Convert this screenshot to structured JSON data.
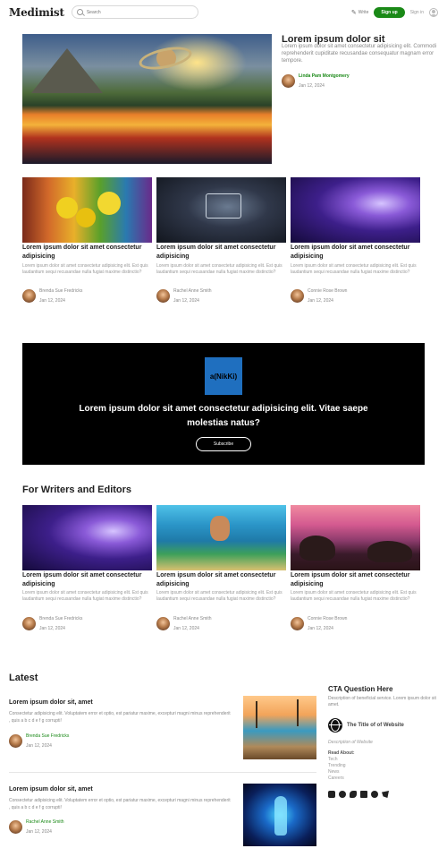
{
  "header": {
    "logo": "Medimist",
    "search_placeholder": "Search",
    "write_label": "Write",
    "signup_label": "Sign up",
    "signin_label": "Sign in"
  },
  "featured": {
    "title": "Lorem ipsum dolor sit",
    "text": "Lorem ipsum dolor sit amet consectetur adipisicing elit. Commodi reprehenderit cupiditate recusandae consequatur magnam error tempore.",
    "author": "Linda Pam Montgomery",
    "date": "Jan 12, 2024"
  },
  "cards_top": [
    {
      "title": "Lorem ipsum dolor sit amet consectetur adipisicing",
      "text": "Lorem ipsum dolor sit amet consectetur adipisicing elit. Est quis laudantium sequi recusandae nulla fugiat maxime distinctio?",
      "author": "Brenda Sue Fredricks",
      "date": "Jan 12, 2024"
    },
    {
      "title": "Lorem ipsum dolor sit amet consectetur adipisicing",
      "text": "Lorem ipsum dolor sit amet consectetur adipisicing elit. Est quis laudantium sequi recusandae nulla fugiat maxime distinctio?",
      "author": "Rachel Anne Smith",
      "date": "Jan 12, 2024"
    },
    {
      "title": "Lorem ipsum dolor sit amet consectetur adipisicing",
      "text": "Lorem ipsum dolor sit amet consectetur adipisicing elit. Est quis laudantium sequi recusandae nulla fugiat maxime distinctio?",
      "author": "Connie Rose Brown",
      "date": "Jan 12, 2024"
    }
  ],
  "cta_banner": {
    "logo": "a(NikKi)",
    "title": "Lorem ipsum dolor sit amet consectetur adipisicing elit. Vitae saepe molestias natus?",
    "button": "Subscribe"
  },
  "writers": {
    "heading": "For Writers and Editors",
    "cards": [
      {
        "title": "Lorem ipsum dolor sit amet consectetur adipisicing",
        "text": "Lorem ipsum dolor sit amet consectetur adipisicing elit. Est quis laudantium sequi recusandae nulla fugiat maxime distinctio?",
        "author": "Brenda Sue Fredricks",
        "date": "Jan 12, 2024"
      },
      {
        "title": "Lorem ipsum dolor sit amet consectetur adipisicing",
        "text": "Lorem ipsum dolor sit amet consectetur adipisicing elit. Est quis laudantium sequi recusandae nulla fugiat maxime distinctio?",
        "author": "Rachel Anne Smith",
        "date": "Jan 12, 2024"
      },
      {
        "title": "Lorem ipsum dolor sit amet consectetur adipisicing",
        "text": "Lorem ipsum dolor sit amet consectetur adipisicing elit. Est quis laudantium sequi recusandae nulla fugiat maxime distinctio?",
        "author": "Connie Rose Brown",
        "date": "Jan 12, 2024"
      }
    ]
  },
  "latest": {
    "heading": "Latest",
    "items": [
      {
        "title": "Lorem ipsum dolor sit, amet",
        "text": "Consectetur adipisicing elit. Voluptatem error et optio, est pariatur maxime, excepturi magni minus reprehenderit , quis a b c d e f g corrupti!",
        "author": "Brenda Sue Fredricks",
        "date": "Jan 12, 2024"
      },
      {
        "title": "Lorem ipsum dolor sit, amet",
        "text": "Consectetur adipisicing elit. Voluptatem error et optio, est pariatur maxime, excepturi magni minus reprehenderit , quis a b c d e f g corrupti!",
        "author": "Rachel Anne Smith",
        "date": "Jan 12, 2024"
      }
    ]
  },
  "sidebar": {
    "heading": "CTA Question Here",
    "desc": "Description of beneficial service. Lorem ipsum dolor sit amet.",
    "site_title": "The Title of of Website",
    "site_desc": "Description of Website",
    "read_about": "Read About:",
    "links": [
      "Tech",
      "Trending",
      "News",
      "Careers"
    ],
    "social_icons": [
      "youtube-icon",
      "github-icon",
      "medium-icon",
      "linkedin-icon",
      "facebook-icon",
      "twitter-icon"
    ]
  },
  "colors": {
    "accent": "#1a8917",
    "banner_bg": "#000000",
    "banner_logo_bg": "#1f6fbf"
  }
}
